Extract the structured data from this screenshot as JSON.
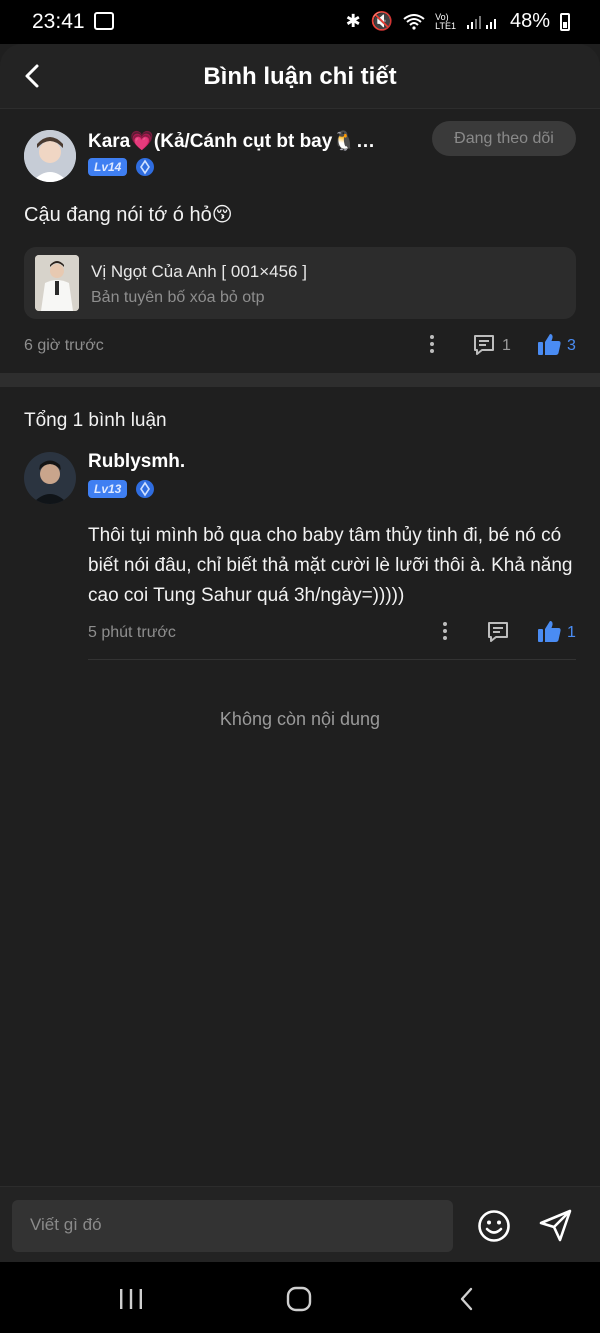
{
  "status_bar": {
    "time": "23:41",
    "battery": "48%"
  },
  "header": {
    "title": "Bình luận chi tiết"
  },
  "post": {
    "username": "Kara💗(Kả/Cánh cụt bt bay🐧…",
    "level": "Lv14",
    "follow_label": "Đang theo dõi",
    "text": "Cậu đang nói tớ ó hỏ😚",
    "card": {
      "title": "Vị Ngọt Của Anh [ 001×456 ]",
      "subtitle": "Bản tuyên bố xóa bỏ otp"
    },
    "time": "6 giờ trước",
    "comment_count": "1",
    "like_count": "3"
  },
  "replies_header": "Tổng 1 bình luận",
  "reply": {
    "username": "Rublysmh.",
    "level": "Lv13",
    "text": "Thôi tụi mình bỏ qua cho baby tâm thủy tinh đi, bé nó có biết nói đâu, chỉ biết thả mặt cười lè lưỡi thôi à. Khả năng cao coi Tung Sahur quá 3h/ngày=)))))",
    "time": "5 phút trước",
    "like_count": "1"
  },
  "end_text": "Không còn nội dung",
  "composer": {
    "placeholder": "Viết gì đó"
  },
  "colors": {
    "accent": "#4a8cf3",
    "background": "#1f1f1f"
  }
}
